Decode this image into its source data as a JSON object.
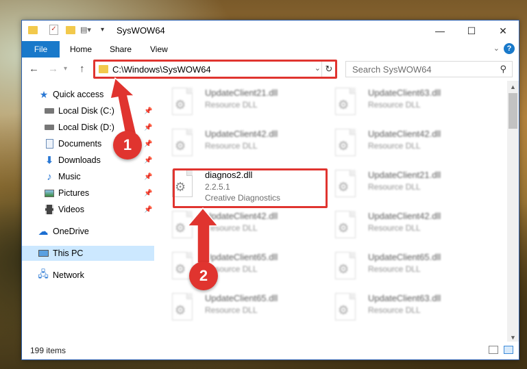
{
  "window": {
    "title": "SysWOW64",
    "minimize": "—",
    "maximize": "☐",
    "close": "✕"
  },
  "ribbon": {
    "file": "File",
    "tabs": [
      "Home",
      "Share",
      "View"
    ],
    "help": "?"
  },
  "address": {
    "path": "C:\\Windows\\SysWOW64",
    "search_placeholder": "Search SysWOW64"
  },
  "sidebar": {
    "items": [
      {
        "label": "Quick access"
      },
      {
        "label": "Local Disk (C:)"
      },
      {
        "label": "Local Disk (D:)"
      },
      {
        "label": "Documents"
      },
      {
        "label": "Downloads"
      },
      {
        "label": "Music"
      },
      {
        "label": "Pictures"
      },
      {
        "label": "Videos"
      },
      {
        "label": "OneDrive"
      },
      {
        "label": "This PC"
      },
      {
        "label": "Network"
      }
    ]
  },
  "files": {
    "left": [
      {
        "name": "UpdateClient21.dll",
        "sub": "Resource DLL"
      },
      {
        "name": "UpdateClient42.dll",
        "sub": "Resource DLL"
      },
      {
        "name": "diagnos2.dll",
        "version": "2.2.5.1",
        "company": "Creative Diagnostics"
      },
      {
        "name": "UpdateClient42.dll",
        "sub": "Resource DLL"
      },
      {
        "name": "UpdateClient65.dll",
        "sub": "Resource DLL"
      },
      {
        "name": "UpdateClient65.dll",
        "sub": "Resource DLL"
      }
    ],
    "right": [
      {
        "name": "UpdateClient63.dll",
        "sub": "Resource DLL"
      },
      {
        "name": "UpdateClient42.dll",
        "sub": "Resource DLL"
      },
      {
        "name": "UpdateClient21.dll",
        "sub": "Resource DLL"
      },
      {
        "name": "UpdateClient42.dll",
        "sub": "Resource DLL"
      },
      {
        "name": "UpdateClient65.dll",
        "sub": "Resource DLL"
      },
      {
        "name": "UpdateClient63.dll",
        "sub": "Resource DLL"
      }
    ]
  },
  "status": {
    "items_count": "199 items"
  },
  "annotations": {
    "step1": "1",
    "step2": "2"
  },
  "colors": {
    "accent": "#1979ca",
    "highlight": "#e0342f",
    "selection": "#cce8ff"
  }
}
